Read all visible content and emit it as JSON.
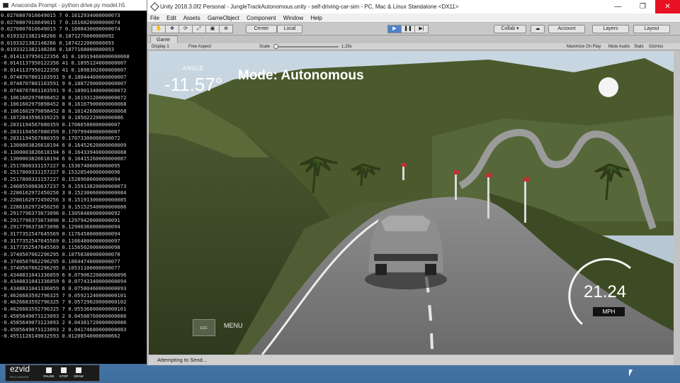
{
  "console": {
    "title": "Anaconda Prompt - python  drive.py model.h5",
    "lines": [
      "0.0270807016649015 7 0.1612934000000073",
      "0.0270807016649015 7 0.1616820000000074",
      "0.0270807016649015 7 0.1608430000000074",
      "0.0193321382148266 0.1871276000000092",
      "0.0193321382148266 0.1874222000000093",
      "0.0193321382148266 0.1877168000000093",
      "-0.0141137950122356 41 0.18919460000000068",
      "-0.0141137950122356 41 0.1895124000000007",
      "-0.0141137950122356 41 0.1898302000000007",
      "-0.0748707801103591 9 0.18844460000000007",
      "-0.0748707801103591 9 0.18872900000000007",
      "-0.0748707801103591 9 0.18901340000000072",
      "-0.1061602979898452 8 0.16193120000000072",
      "-0.1061602979898452 8 0.16167900000000068",
      "-0.1061602979898452 8 0.16142680000000068",
      "-0.1072843596339225 8 0.1850222000000086",
      "-0.2031194567680359 0.17086580000000007",
      "-0.2031194567680359 0.17079940000000007",
      "-0.2031194567680359 0.17073300000000072",
      "-0.1300003826618194 6 0.16452620000000009",
      "-0.1300003826618194 6 0.16433940000000088",
      "-0.1300003826618194 6 0.16415260000000087",
      "-0.2517800331157227 0.15367400000000095",
      "-0.2517800331157227 0.15328540000000096",
      "-0.2517800331157227 0.15289680000000094",
      "-0.2408550083637237 5 0.15913820000000073",
      "-0.2286162972450256 3 0.15230060000000084",
      "-0.2286162972450256 3 0.15191300000000085",
      "-0.2286162972450256 3 0.15152540000000086",
      "-0.2917796373673096 0.13058480000000092",
      "-0.2917796373673096 0.12979420000000091",
      "-0.2917796373673096 0.12900360000000094",
      "-0.3177352547645569 0.11764580000000094",
      "-0.3177352547645569 0.11664800000000097",
      "-0.3177352547645569 0.11565020000000098",
      "-0.3740507662296295 0.10758380000000078",
      "-0.3740507662296295 0.10644740000000077",
      "-0.3740507662296295 0.10531100000000077",
      "-0.4348831041336059 6 0.07906220000000096",
      "-0.4348831041336059 6 0.07743340000000094",
      "-0.4348831041336059 6 0.07580460000000093",
      "-0.4626683592796325 7 0.05921240000000101",
      "-0.4626683592796325 7 0.05729020000000102",
      "-0.4626683592796325 7 0.05536800000000101",
      "-0.4585649073123093 2 0.04588760000000086",
      "-0.4585649073123093 2 0.04381720000000086",
      "-0.4585649073123093 2 0.04174680000000083",
      "-0.4551128149032593 0.01208540000000662"
    ]
  },
  "unity": {
    "title": "Unity 2018.3.0f2 Personal - JungleTrackAutonomous.unity - self-driving-car-sim - PC, Mac & Linux Standalone <DX11>",
    "window_controls": {
      "minimize": "—",
      "maximize": "❐",
      "close": "✕"
    },
    "menu": [
      "File",
      "Edit",
      "Assets",
      "GameObject",
      "Component",
      "Window",
      "Help"
    ],
    "toolbar": {
      "tools": [
        "✋",
        "✥",
        "⟳",
        "⤢",
        "▣",
        "⊕"
      ],
      "pivot": "Center",
      "space": "Local",
      "play": "▶",
      "pause": "❚❚",
      "step": "▶|",
      "collab": "Collab ▾",
      "cloud": "☁",
      "account": "Account",
      "layers": "Layers",
      "layout": "Layout"
    },
    "game_tab": {
      "label": "Game"
    },
    "game_controls": {
      "display": "Display 1",
      "aspect": "Free Aspect",
      "scale_label": "Scale",
      "scale_value": "1.25x",
      "maximize_on_play": "Maximize On Play",
      "mute_audio": "Mute Audio",
      "stats": "Stats",
      "gizmos": "Gizmos"
    },
    "hud": {
      "angle_label": "ANGLE",
      "angle_value": "-11.57°",
      "mode": "Mode: Autonomous",
      "speed_value": "21.24",
      "speed_unit": "MPH",
      "esc": "ESC",
      "menu": "MENU"
    },
    "status": "Attempting to Send..."
  },
  "recorder": {
    "logo": "ezvid",
    "logo_sub": "RECORDER",
    "buttons": [
      "PAUSE",
      "STOP",
      "DRAW"
    ]
  }
}
